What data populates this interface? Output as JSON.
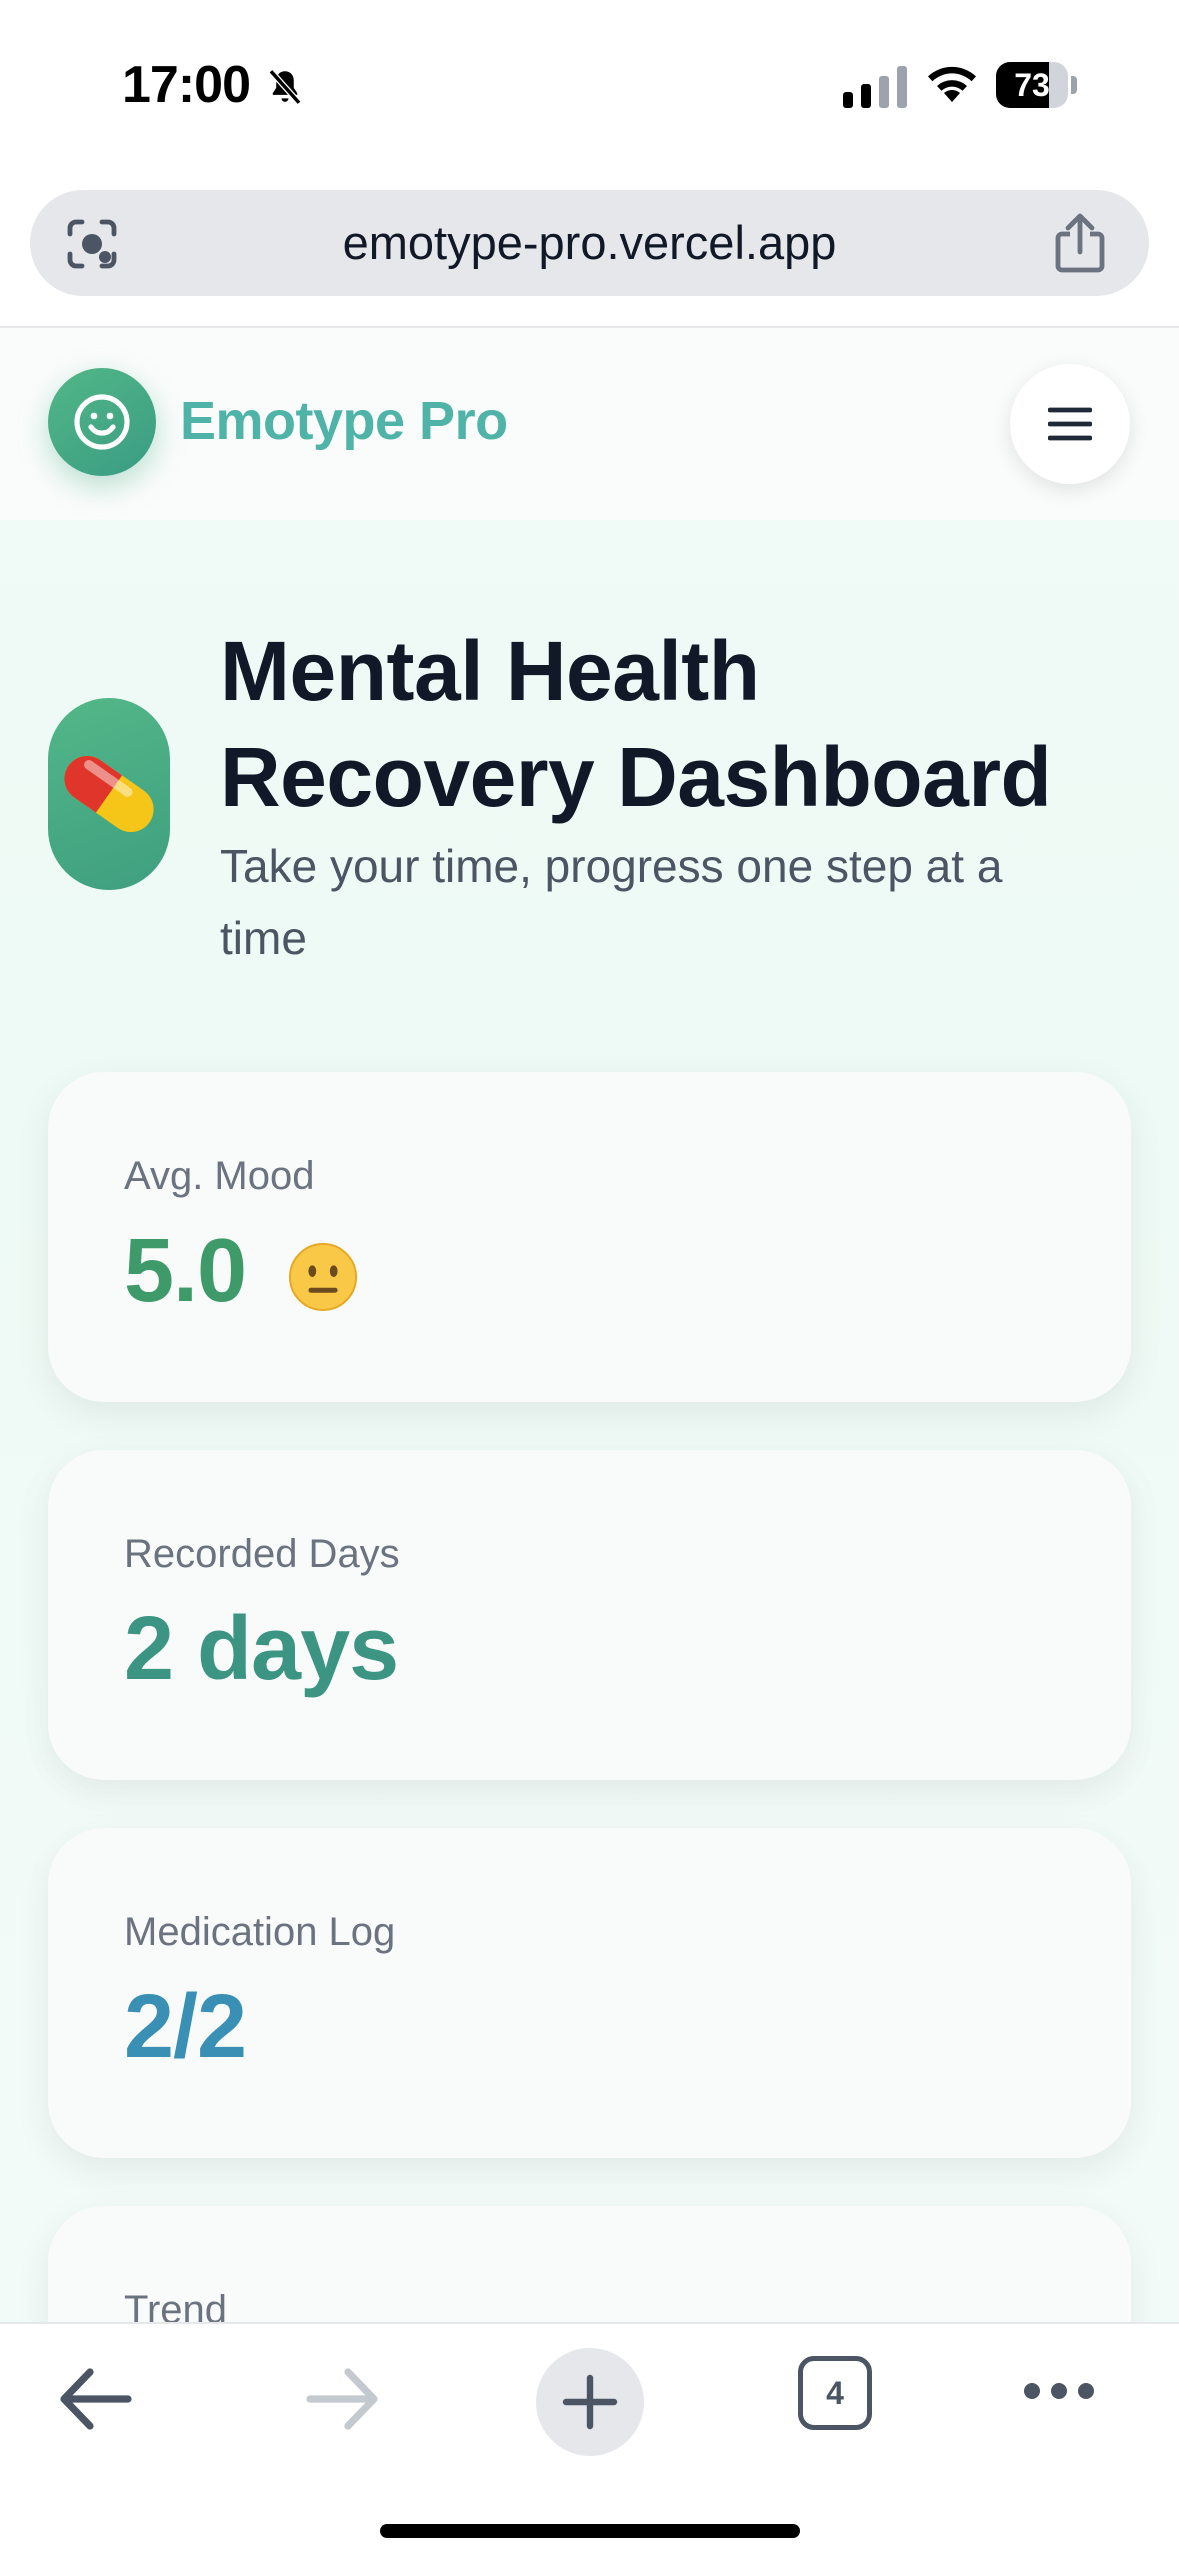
{
  "status_bar": {
    "time": "17:00",
    "battery_level": "73",
    "battery_fraction": 0.73,
    "icons": [
      "bell-slash-icon",
      "cellular-signal-icon",
      "wifi-icon",
      "battery-icon"
    ]
  },
  "browser": {
    "url": "emotype-pro.vercel.app",
    "tab_count": "4",
    "icons": [
      "lens-icon",
      "share-icon",
      "back-arrow-icon",
      "forward-arrow-icon",
      "plus-icon",
      "tabs-icon",
      "more-dots-icon"
    ]
  },
  "app": {
    "brand": "Emotype Pro",
    "brand_color": "#4fb3a8",
    "accent_green": "#52b788",
    "icons": [
      "smiley-icon",
      "hamburger-menu-icon",
      "pill-icon",
      "neutral-face-icon"
    ]
  },
  "hero": {
    "title": "Mental Health Recovery Dashboard",
    "subtitle": "Take your time, progress one step at a time"
  },
  "stats": [
    {
      "label": "Avg. Mood",
      "value": "5.0",
      "color": "#3f9a6a",
      "icon": "neutral-face-icon"
    },
    {
      "label": "Recorded Days",
      "value": "2 days",
      "color": "#3c9483"
    },
    {
      "label": "Medication Log",
      "value": "2/2",
      "color": "#3a8fb5"
    },
    {
      "label": "Trend",
      "value": ""
    }
  ]
}
